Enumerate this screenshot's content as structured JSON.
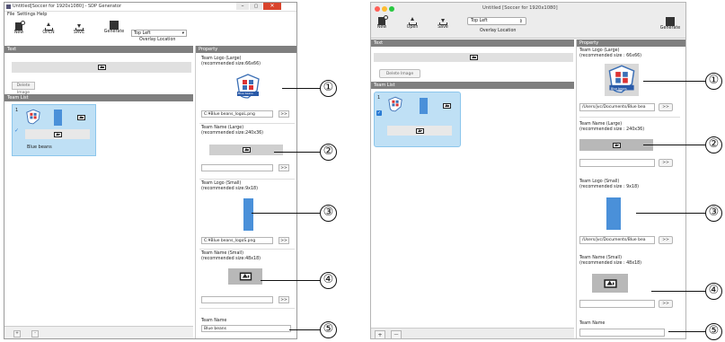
{
  "win_left": {
    "title": "Untitled[Soccer for 1920x1080] - SDP Generator",
    "menu": [
      "File",
      "Settings",
      "Help"
    ],
    "toolbar": {
      "new": "New",
      "open": "OPEN",
      "save": "SAVE",
      "generate": "Generate",
      "overlay_value": "Top Left",
      "overlay_label": "Overlay Location"
    },
    "text_header": "Text",
    "delete_image": "Delete Image",
    "team_list_header": "Team List",
    "team": {
      "number": "1",
      "name": "Blue beans"
    },
    "property_header": "Property",
    "prop_logo_large": "Team Logo (Large)\n(recommended size:66x66)",
    "prop_logo_large_path": "C:¥Blue beans_logoL.png",
    "prop_name_large": "Team Name (Large)\n(recommended size:240x36)",
    "prop_logo_small": "Team Logo (Small)\n(recommended size:9x18)",
    "prop_logo_small_path": "C:¥Blue beans_logoS.png",
    "prop_name_small": "Team Name (Small)\n(recommended size:48x18)",
    "prop_team_name": "Team Name",
    "prop_team_name_value": "Blue beans",
    "browse": ">>",
    "add": "+",
    "remove": "-"
  },
  "win_right": {
    "title": "Untitled [Soccer for 1920x1080]",
    "toolbar": {
      "new": "New",
      "open": "Open",
      "save": "Save",
      "generate": "Generate",
      "overlay_value": "Top Left",
      "overlay_label": "Overlay Location"
    },
    "text_header": "Text",
    "delete_image": "Delete Image",
    "team_list_header": "Team List",
    "team": {
      "number": "1"
    },
    "property_header": "Property",
    "prop_logo_large": "Team Logo (Large)\n(recommended size : 66x66)",
    "prop_logo_large_path": "/Users/jvc/Documents/Blue bea",
    "prop_name_large": "Team Name (Large)\n(recommended size : 240x36)",
    "prop_logo_small": "Team Logo (Small)\n(recommended size : 9x18)",
    "prop_logo_small_path": "/Users/jvc/Documents/Blue bea",
    "prop_name_small": "Team Name (Small)\n(recommended size : 48x18)",
    "prop_team_name": "Team Name",
    "browse": ">>",
    "add": "+",
    "remove": "—"
  },
  "logo_banner": "Blue beans",
  "callouts": [
    "①",
    "②",
    "③",
    "④",
    "⑤"
  ],
  "colors": {
    "selection_blue": "#bfe0f5",
    "logo_blue": "#4a90d9",
    "header_gray": "#7f7f7f"
  }
}
